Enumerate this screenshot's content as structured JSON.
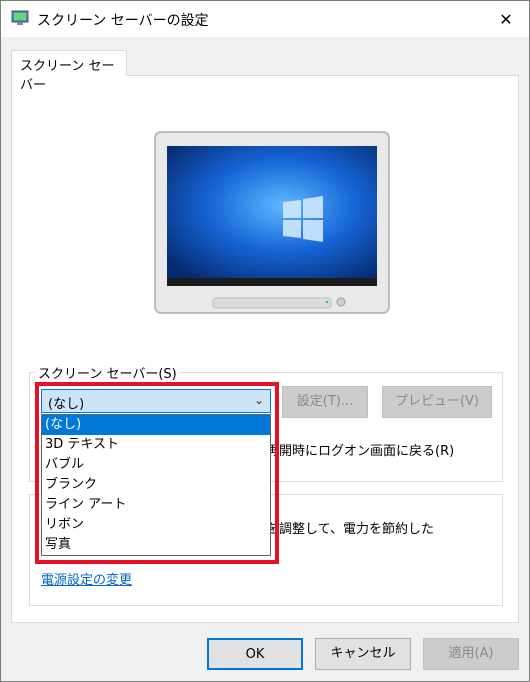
{
  "window": {
    "title": "スクリーン セーバーの設定",
    "close_glyph": "✕"
  },
  "tab": {
    "label": "スクリーン セーバー"
  },
  "screensaver_group": {
    "label": "スクリーン セーバー(S)",
    "combo_value": "(なし)",
    "settings_button": "設定(T)...",
    "preview_button": "プレビュー(V)",
    "resume_text": "再開時にログオン画面に戻る(R)"
  },
  "dropdown": {
    "options": [
      "(なし)",
      "3D テキスト",
      "バブル",
      "ブランク",
      "ライン アート",
      "リボン",
      "写真"
    ],
    "selected_index": 0
  },
  "power_group": {
    "text": "を調整して、電力を節約した",
    "link": "電源設定の変更"
  },
  "footer": {
    "ok": "OK",
    "cancel": "キャンセル",
    "apply": "適用(A)"
  },
  "colors": {
    "highlight_box": "#e81123",
    "selection": "#0078d7",
    "link": "#0066cc"
  }
}
